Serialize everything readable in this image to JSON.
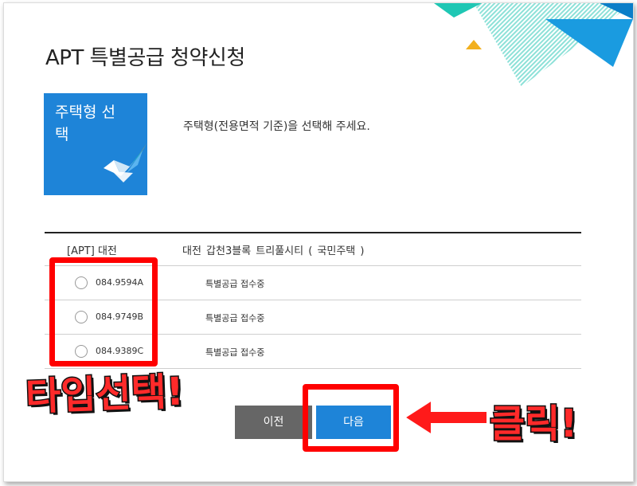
{
  "page": {
    "title": "APT 특별공급 청약신청",
    "tile_label": "주택형 선택",
    "instruction": "주택형(전용면적 기준)을 선택해 주세요."
  },
  "table": {
    "apt_type": "[APT] 대전",
    "complex_name": "대전 갑천3블록 트리풀시티 ( 국민주택 )",
    "options": [
      {
        "type": "084.9594A",
        "status": "특별공급 접수중"
      },
      {
        "type": "084.9749B",
        "status": "특별공급 접수중"
      },
      {
        "type": "084.9389C",
        "status": "특별공급 접수중"
      }
    ]
  },
  "buttons": {
    "prev_label": "이전",
    "next_label": "다음"
  },
  "annotations": {
    "select_type": "타입선택!",
    "click": "클릭!"
  },
  "colors": {
    "accent_blue": "#1e84d8",
    "prev_gray": "#666666",
    "highlight_red": "#ff0000",
    "deco_teal": "#1fc7b4",
    "deco_yellow": "#f2b01e"
  }
}
